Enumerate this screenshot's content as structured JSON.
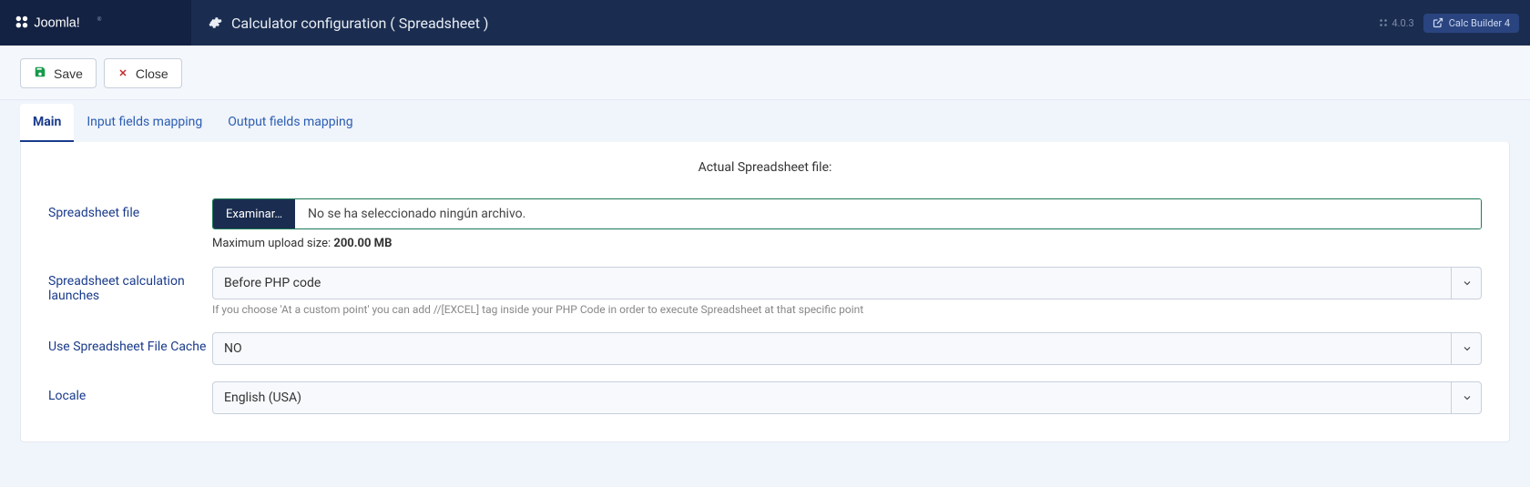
{
  "brand": "Joomla!",
  "header": {
    "title": "Calculator configuration ( Spreadsheet )",
    "version": "4.0.3",
    "badge": "Calc Builder 4"
  },
  "toolbar": {
    "save": "Save",
    "close": "Close"
  },
  "tabs": {
    "main": "Main",
    "input_mapping": "Input fields mapping",
    "output_mapping": "Output fields mapping"
  },
  "panel": {
    "actual_file_label": "Actual Spreadsheet file:",
    "fields": {
      "spreadsheet_file": {
        "label": "Spreadsheet file",
        "browse_button": "Examinar…",
        "no_file_text": "No se ha seleccionado ningún archivo.",
        "upload_hint_prefix": "Maximum upload size: ",
        "upload_hint_value": "200.00 MB"
      },
      "calc_launches": {
        "label": "Spreadsheet calculation launches",
        "value": "Before PHP code",
        "help": "If you choose 'At a custom point' you can add //[EXCEL] tag inside your PHP Code in order to execute Spreadsheet at that specific point"
      },
      "use_cache": {
        "label": "Use Spreadsheet File Cache",
        "value": "NO"
      },
      "locale": {
        "label": "Locale",
        "value": "English (USA)"
      }
    }
  }
}
